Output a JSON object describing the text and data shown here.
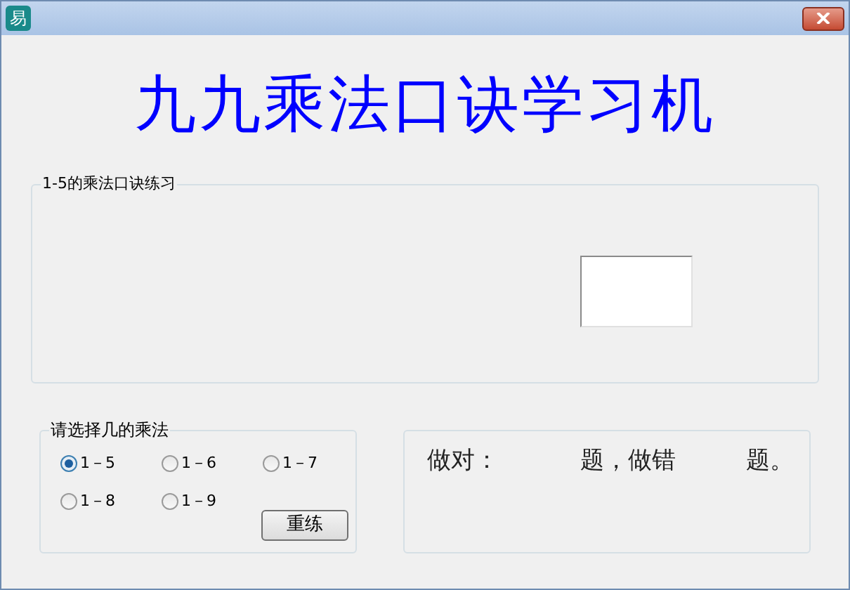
{
  "window": {
    "title_icon_text": "易"
  },
  "heading": "九九乘法口诀学习机",
  "practice_group": {
    "label": "1-5的乘法口诀练习"
  },
  "range_group": {
    "label": "请选择几的乘法",
    "options": [
      {
        "label": "1－5",
        "selected": true
      },
      {
        "label": "1－6",
        "selected": false
      },
      {
        "label": "1－7",
        "selected": false
      },
      {
        "label": "1－8",
        "selected": false
      },
      {
        "label": "1－9",
        "selected": false
      }
    ],
    "reset_button": "重练"
  },
  "score": [
    "做对：",
    "题，做错",
    "题。"
  ]
}
